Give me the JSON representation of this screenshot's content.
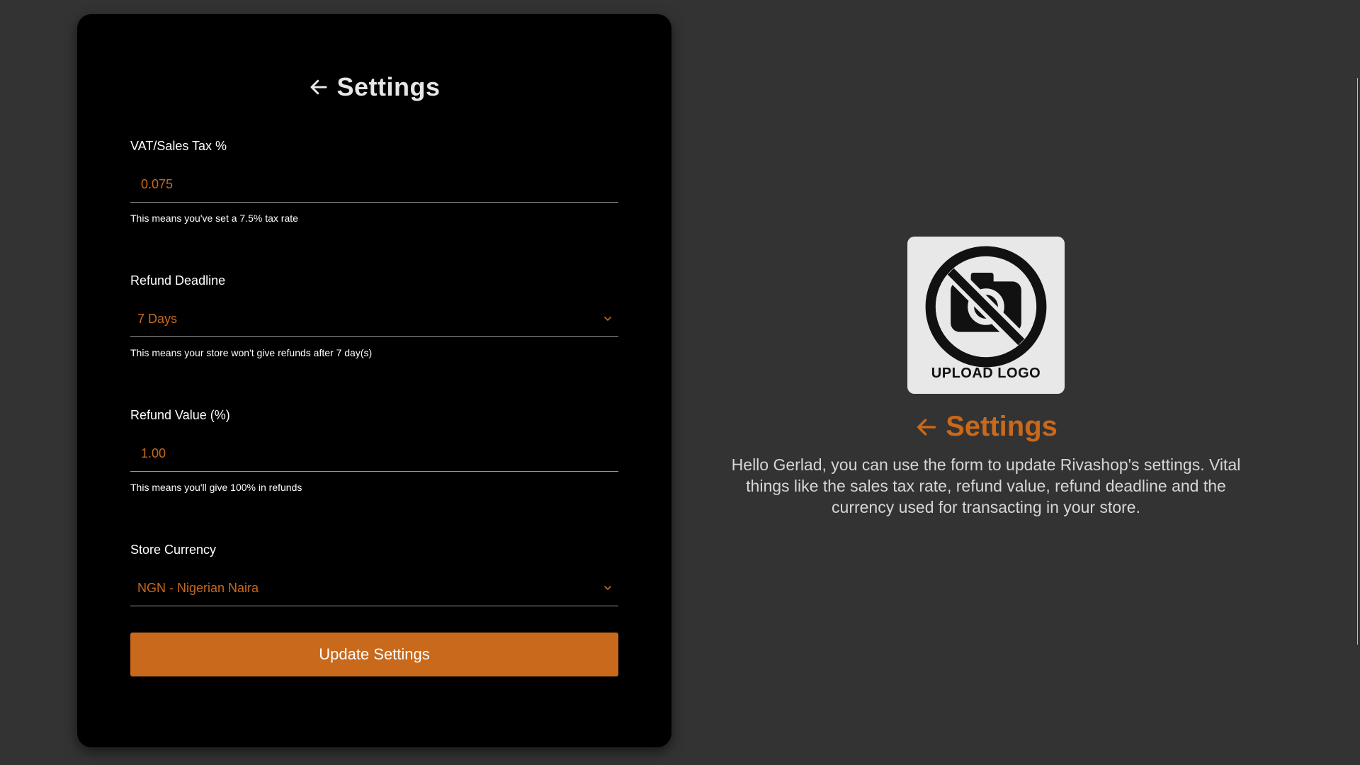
{
  "form": {
    "title": "Settings",
    "fields": {
      "vat": {
        "label": "VAT/Sales Tax %",
        "value": "0.075",
        "hint": "This means you've set a 7.5% tax rate"
      },
      "refund_deadline": {
        "label": "Refund Deadline",
        "selected": "7 Days",
        "hint": "This means your store won't give refunds after 7 day(s)"
      },
      "refund_value": {
        "label": "Refund Value (%)",
        "value": "1.00",
        "hint": "This means you'll give 100% in refunds"
      },
      "currency": {
        "label": "Store Currency",
        "selected": "NGN - Nigerian Naira"
      }
    },
    "submit_label": "Update Settings"
  },
  "info": {
    "logo_label": "UPLOAD LOGO",
    "title": "Settings",
    "description": "Hello Gerlad, you can use the form to update Rivashop's settings. Vital things like the sales tax rate, refund value, refund deadline and the currency used for transacting in your store."
  },
  "colors": {
    "accent": "#c8691b",
    "page_background": "#333333",
    "card_background": "#000000",
    "logo_background": "#e8e8e8"
  },
  "icons": {
    "back": "arrow-left-icon",
    "dropdown": "chevron-down-icon",
    "logo_placeholder": "no-camera-icon"
  }
}
